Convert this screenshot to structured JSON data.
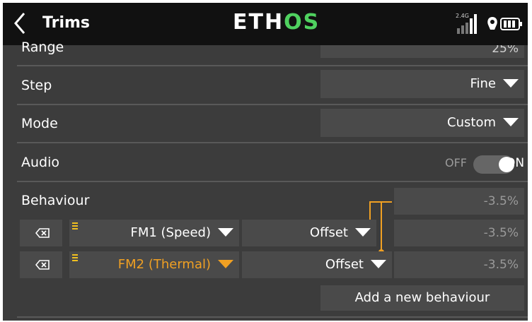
{
  "header": {
    "title": "Trims",
    "logo_part1": "ETH",
    "logo_part2": "OS",
    "signal_label": "2.4G"
  },
  "rows": {
    "range_label": "Range",
    "range_value": "25%",
    "step_label": "Step",
    "step_value": "Fine",
    "mode_label": "Mode",
    "mode_value": "Custom",
    "audio_label": "Audio",
    "audio_off": "OFF",
    "audio_on": "ON",
    "audio_state": true
  },
  "behaviour": {
    "label": "Behaviour",
    "default_value": "-3.5%",
    "items": [
      {
        "flight_mode": "FM1 (Speed)",
        "mode": "Offset",
        "value": "-3.5%",
        "active": false
      },
      {
        "flight_mode": "FM2 (Thermal)",
        "mode": "Offset",
        "value": "-3.5%",
        "active": true
      }
    ],
    "add_label": "Add a new behaviour"
  },
  "colors": {
    "accent": "#f0a023",
    "background": "#3c3c3c",
    "header": "#111111",
    "field": "#4a4a4a",
    "logo_green": "#4fd15f"
  }
}
